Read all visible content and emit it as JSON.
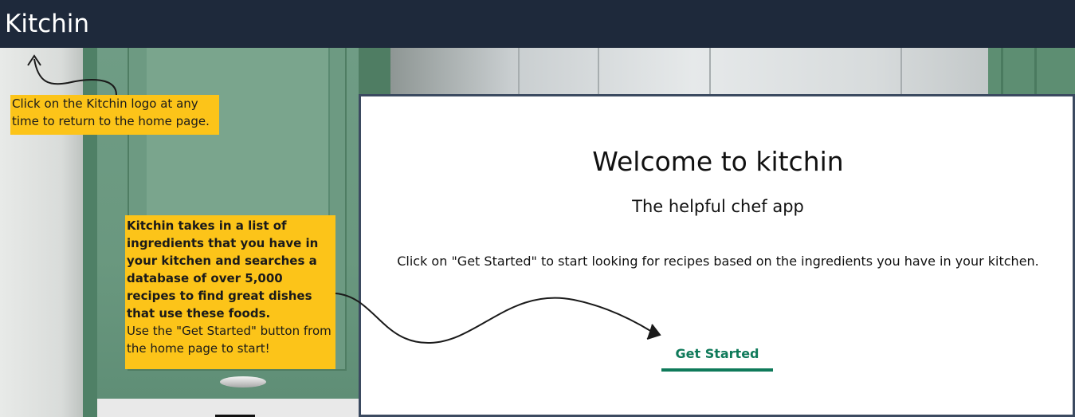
{
  "header": {
    "logo_text": "Kitchin"
  },
  "tooltips": {
    "logo_tip": "Click on the Kitchin logo at any time to return to the home page.",
    "start_tip_bold": "Kitchin takes in a list of ingredients that you have in your kitchen and searches a database of over 5,000 recipes to find great dishes that use these foods.",
    "start_tip_normal": "Use the \"Get Started\" button from the home page to start!"
  },
  "welcome": {
    "title": "Welcome to kitchin",
    "subtitle": "The helpful chef app",
    "description": "Click on \"Get Started\" to start looking for recipes based on the ingredients you have in your kitchen.",
    "button_label": "Get Started"
  },
  "colors": {
    "header_bg": "#1e293b",
    "tooltip_bg": "#fcc419",
    "accent": "#0f7a5a",
    "card_border": "#3b4a60"
  }
}
